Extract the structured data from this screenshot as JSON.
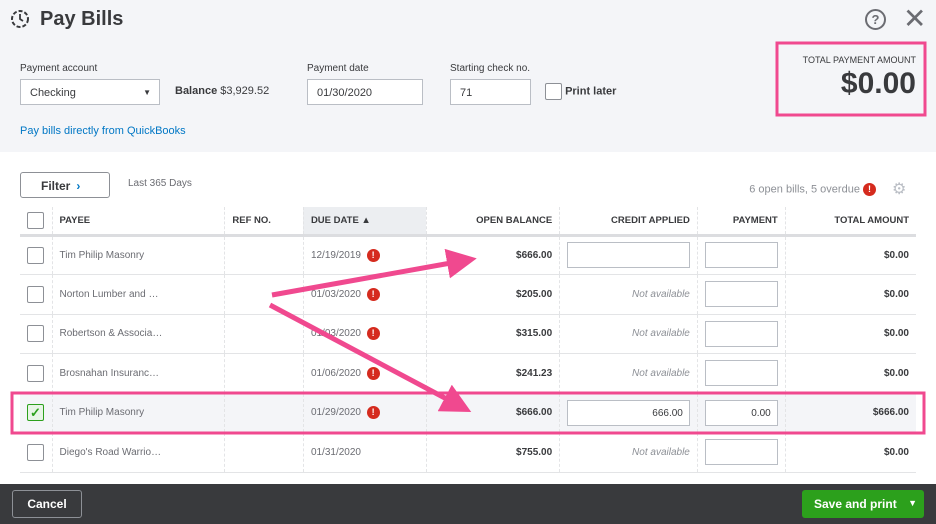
{
  "header": {
    "title": "Pay Bills",
    "help": "?",
    "close": "✕"
  },
  "form": {
    "payment_account_label": "Payment account",
    "payment_account": "Checking",
    "balance_label": "Balance",
    "balance": "$3,929.52",
    "payment_date_label": "Payment date",
    "payment_date": "01/30/2020",
    "check_no_label": "Starting check no.",
    "check_no": "71",
    "print_later": "Print later",
    "link": "Pay bills directly from QuickBooks"
  },
  "total": {
    "label": "TOTAL PAYMENT AMOUNT",
    "value": "$0.00"
  },
  "toolbar": {
    "filter": "Filter",
    "range": "Last 365 Days",
    "open_bills": "6 open bills, 5 overdue"
  },
  "table": {
    "columns": [
      "PAYEE",
      "REF NO.",
      "DUE DATE ▲",
      "OPEN BALANCE",
      "CREDIT APPLIED",
      "PAYMENT",
      "TOTAL AMOUNT"
    ],
    "rows": [
      {
        "payee": "Tim Philip Masonry",
        "ref": "",
        "due": "12/19/2019",
        "overdue": true,
        "open": "$666.00",
        "credit": "",
        "credit_na": false,
        "payment": "",
        "total": "$0.00",
        "checked": false
      },
      {
        "payee": "Norton Lumber and …",
        "ref": "",
        "due": "01/03/2020",
        "overdue": true,
        "open": "$205.00",
        "credit": "Not available",
        "credit_na": true,
        "payment": "",
        "total": "$0.00",
        "checked": false
      },
      {
        "payee": "Robertson & Associa…",
        "ref": "",
        "due": "01/03/2020",
        "overdue": true,
        "open": "$315.00",
        "credit": "Not available",
        "credit_na": true,
        "payment": "",
        "total": "$0.00",
        "checked": false
      },
      {
        "payee": "Brosnahan Insuranc…",
        "ref": "",
        "due": "01/06/2020",
        "overdue": true,
        "open": "$241.23",
        "credit": "Not available",
        "credit_na": true,
        "payment": "",
        "total": "$0.00",
        "checked": false
      },
      {
        "payee": "Tim Philip Masonry",
        "ref": "",
        "due": "01/29/2020",
        "overdue": true,
        "open": "$666.00",
        "credit": "666.00",
        "credit_na": false,
        "payment": "0.00",
        "total": "$666.00",
        "checked": true
      },
      {
        "payee": "Diego's Road Warrio…",
        "ref": "",
        "due": "01/31/2020",
        "overdue": false,
        "open": "$755.00",
        "credit": "Not available",
        "credit_na": true,
        "payment": "",
        "total": "$0.00",
        "checked": false
      }
    ]
  },
  "footer": {
    "cancel": "Cancel",
    "save": "Save and print"
  },
  "colors": {
    "accent": "#2ca01c",
    "link": "#0077c5",
    "overdue": "#d52b1e",
    "annotation": "#f0498f"
  }
}
